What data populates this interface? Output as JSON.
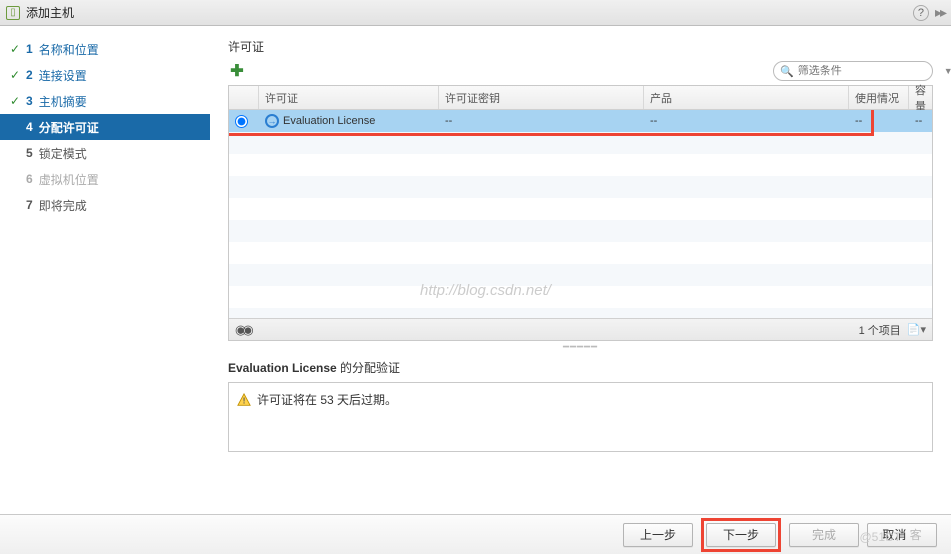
{
  "titlebar": {
    "title": "添加主机"
  },
  "steps": [
    {
      "num": "1",
      "label": "名称和位置",
      "state": "done"
    },
    {
      "num": "2",
      "label": "连接设置",
      "state": "done"
    },
    {
      "num": "3",
      "label": "主机摘要",
      "state": "done"
    },
    {
      "num": "4",
      "label": "分配许可证",
      "state": "current"
    },
    {
      "num": "5",
      "label": "锁定模式",
      "state": "pending"
    },
    {
      "num": "6",
      "label": "虚拟机位置",
      "state": "disabled"
    },
    {
      "num": "7",
      "label": "即将完成",
      "state": "pending"
    }
  ],
  "content": {
    "section_title": "许可证",
    "filter_placeholder": "筛选条件",
    "columns": {
      "name": "许可证",
      "key": "许可证密钥",
      "product": "产品",
      "usage": "使用情况",
      "capacity": "容量"
    },
    "rows": [
      {
        "selected": true,
        "name": "Evaluation License",
        "key": "--",
        "product": "--",
        "usage": "--",
        "capacity": "--"
      }
    ],
    "footer_count": "1 个项目",
    "assign_title_prefix": "Evaluation License",
    "assign_title_suffix": " 的分配验证",
    "warning_text": "许可证将在 53 天后过期。"
  },
  "buttons": {
    "back": "上一步",
    "next": "下一步",
    "finish": "完成",
    "cancel": "取消"
  },
  "watermark": "http://blog.csdn.net/",
  "bottom_wm_left": "@51CT",
  "bottom_wm_right": "客"
}
